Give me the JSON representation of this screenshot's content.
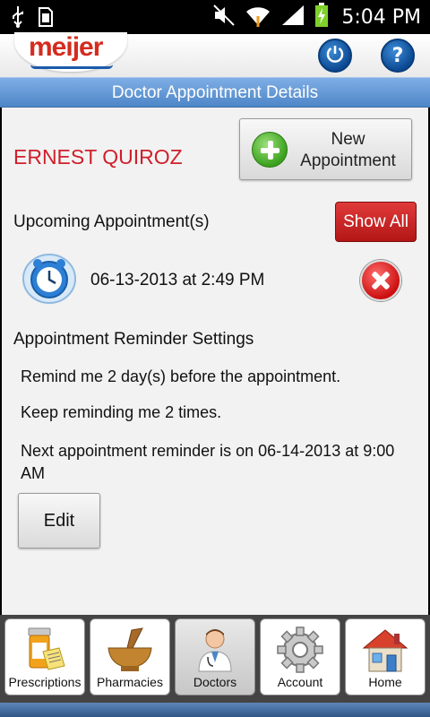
{
  "status_bar": {
    "time": "5:04 PM",
    "icons": [
      "usb-icon",
      "sd-card-icon",
      "mute-icon",
      "wifi-icon",
      "signal-icon",
      "battery-charging-icon"
    ]
  },
  "header": {
    "logo_text": "meijer",
    "buttons": [
      "power-icon",
      "help-icon"
    ],
    "help_glyph": "?"
  },
  "title": "Doctor Appointment Details",
  "patient_name": "ERNEST QUIROZ",
  "new_appointment_label": "New Appointment",
  "upcoming": {
    "label": "Upcoming Appointment(s)",
    "show_all_label": "Show All",
    "appointments": [
      {
        "datetime": "06-13-2013 at 2:49 PM"
      }
    ]
  },
  "reminder_settings": {
    "label": "Appointment Reminder Settings",
    "remind_text": "Remind me 2 day(s) before the appointment.",
    "repeat_text": "Keep reminding me 2 times.",
    "next_text": "Next appointment reminder is on 06-14-2013 at 9:00 AM",
    "edit_label": "Edit"
  },
  "tabs": [
    {
      "label": "Prescriptions",
      "icon": "prescription-bottle-icon",
      "active": false
    },
    {
      "label": "Pharmacies",
      "icon": "mortar-pestle-icon",
      "active": false
    },
    {
      "label": "Doctors",
      "icon": "doctor-icon",
      "active": true
    },
    {
      "label": "Account",
      "icon": "gear-icon",
      "active": false
    },
    {
      "label": "Home",
      "icon": "home-icon",
      "active": false
    }
  ],
  "colors": {
    "brand_red": "#d52b1e",
    "patient_name": "#d01f2b",
    "title_bar": "#5f93d0",
    "show_all": "#c52121"
  }
}
